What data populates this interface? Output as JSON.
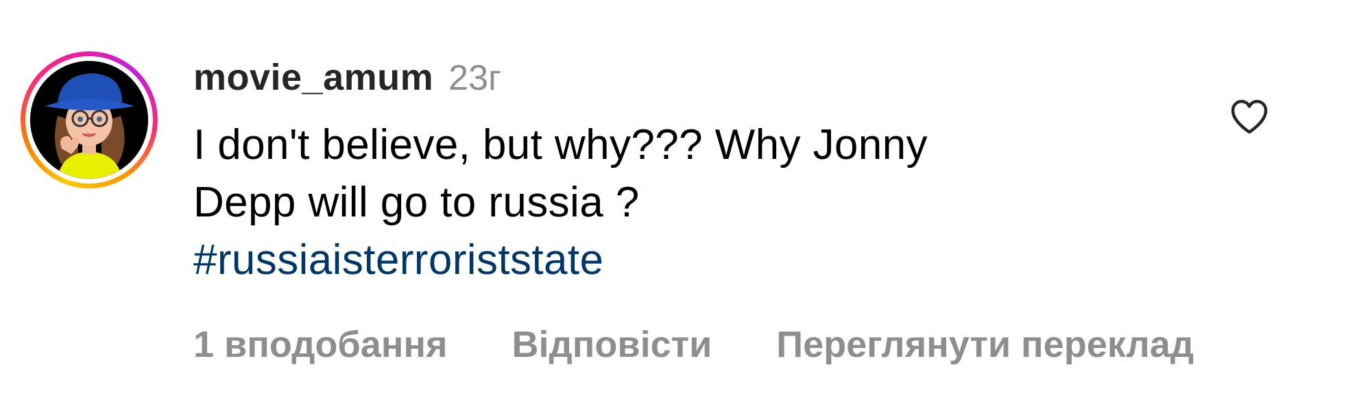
{
  "comment": {
    "username": "movie_amum",
    "time": "23г",
    "text_lines": [
      "I don't believe, but why??? Why Jonny",
      "Depp will go to russia ?"
    ],
    "hashtag": "#russiaisterroriststate",
    "like_icon": "heart-outline-icon",
    "actions": {
      "likes": "1 вподобання",
      "reply": "Відповісти",
      "translate": "Переглянути переклад"
    }
  },
  "colors": {
    "username": "#262626",
    "secondary": "#8e8e8e",
    "hashtag": "#00376b",
    "text": "#000000"
  }
}
